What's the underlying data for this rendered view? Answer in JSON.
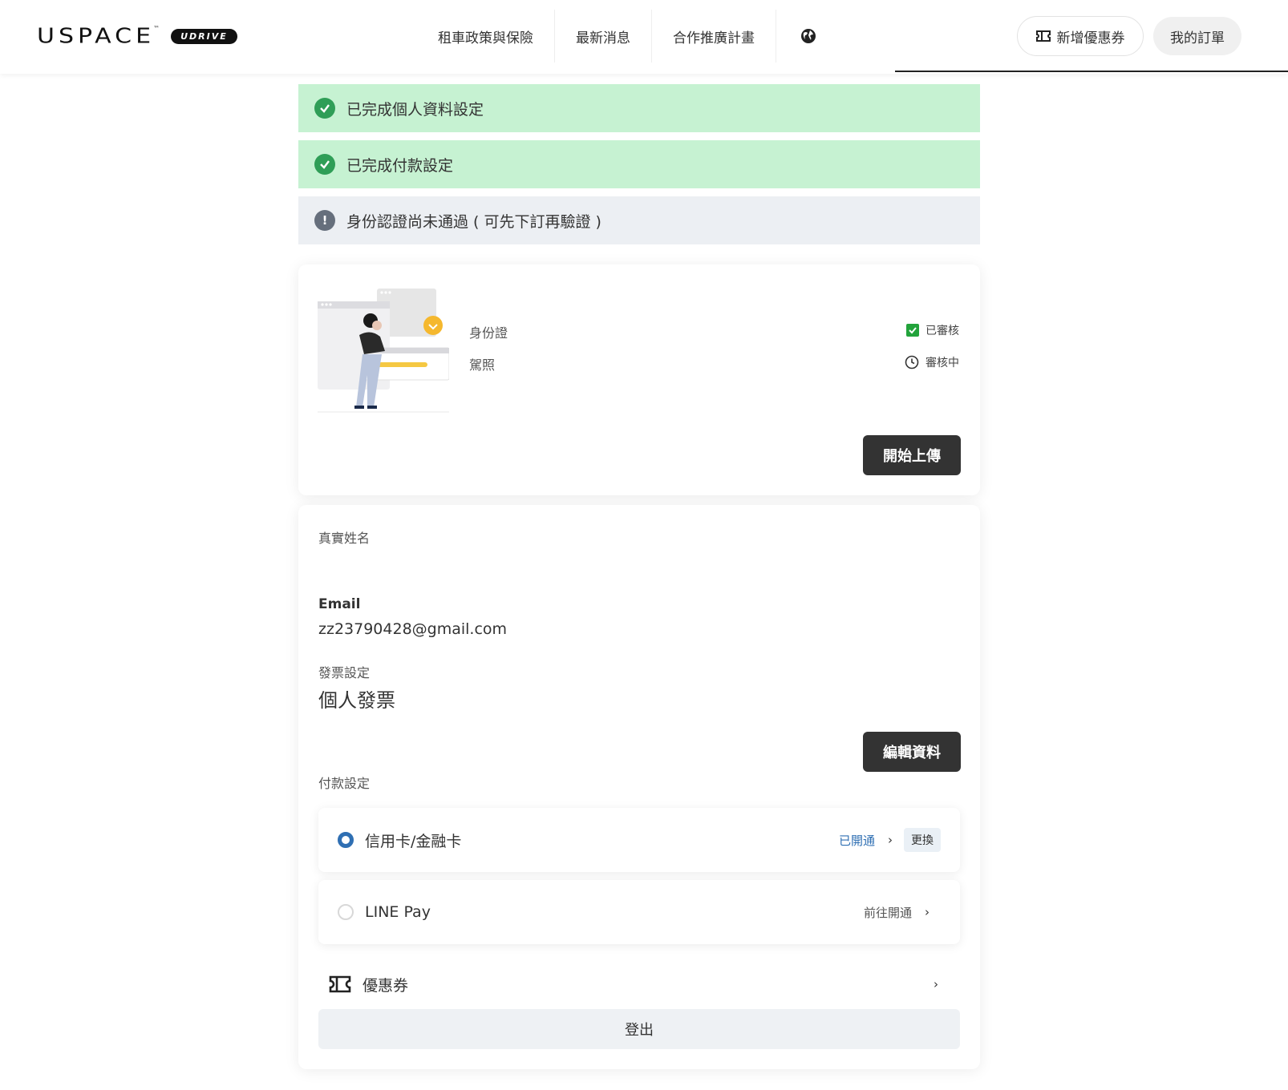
{
  "header": {
    "logo_text": "USPACE",
    "logo_tm": "™",
    "logo_badge": "UDRIVE",
    "nav": [
      {
        "label": "租車政策與保險"
      },
      {
        "label": "最新消息"
      },
      {
        "label": "合作推廣計畫"
      }
    ],
    "globe_icon": "globe-icon",
    "coupon_button": "新增優惠券",
    "orders_button": "我的訂單"
  },
  "status_bars": [
    {
      "text": "已完成個人資料設定",
      "state": "ok"
    },
    {
      "text": "已完成付款設定",
      "state": "ok"
    },
    {
      "text": "身份認證尚未通過 ( 可先下訂再驗證 )",
      "state": "warn"
    }
  ],
  "verification": {
    "documents": [
      {
        "label": "身份證",
        "status": "已審核",
        "status_icon": "checkbox-checked-icon"
      },
      {
        "label": "駕照",
        "status": "審核中",
        "status_icon": "clock-icon"
      }
    ],
    "upload_button": "開始上傳"
  },
  "profile": {
    "name_label": "真實姓名",
    "name_value": "",
    "email_label": "Email",
    "email_value": "zz23790428@gmail.com",
    "invoice_label": "發票設定",
    "invoice_value": "個人發票",
    "edit_button": "編輯資料"
  },
  "payment": {
    "label": "付款設定",
    "methods": [
      {
        "name": "信用卡/金融卡",
        "state": "已開通",
        "selected": true,
        "action": "更換"
      },
      {
        "name": "LINE Pay",
        "state": "前往開通",
        "selected": false
      }
    ],
    "chevron": "›"
  },
  "coupon_row": {
    "label": "優惠券",
    "icon": "ticket-icon",
    "chevron": "›"
  },
  "logout_button": "登出",
  "colors": {
    "success_bg": "#c6f2d2",
    "success_icon": "#2f9e57",
    "warn_bg": "#eceff3",
    "dark_button": "#333333",
    "link_blue": "#2f6fb3"
  }
}
